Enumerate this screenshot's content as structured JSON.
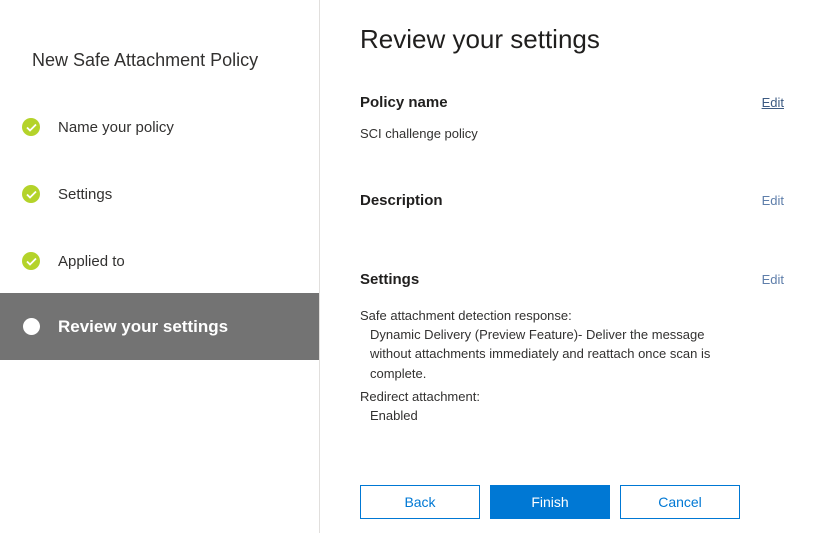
{
  "wizard": {
    "title": "New Safe Attachment Policy",
    "steps": [
      {
        "label": "Name your policy",
        "status": "complete"
      },
      {
        "label": "Settings",
        "status": "complete"
      },
      {
        "label": "Applied to",
        "status": "complete"
      },
      {
        "label": "Review your settings",
        "status": "current"
      }
    ]
  },
  "main": {
    "title": "Review your settings",
    "sections": {
      "policy_name": {
        "label": "Policy name",
        "edit_label": "Edit",
        "value": "SCI challenge policy"
      },
      "description": {
        "label": "Description",
        "edit_label": "Edit",
        "value": ""
      },
      "settings": {
        "label": "Settings",
        "edit_label": "Edit",
        "detection_label": "Safe attachment detection response:",
        "detection_value_line1": "Dynamic Delivery (Preview Feature)- Deliver the message",
        "detection_value_line2": "without attachments immediately and reattach once scan is",
        "detection_value_line3": "complete.",
        "redirect_label": "Redirect attachment:",
        "redirect_value": "Enabled"
      }
    }
  },
  "buttons": {
    "back": "Back",
    "finish": "Finish",
    "cancel": "Cancel"
  },
  "colors": {
    "accent": "#0078d4",
    "check": "#b4d32a",
    "active_step_bg": "#737373"
  }
}
